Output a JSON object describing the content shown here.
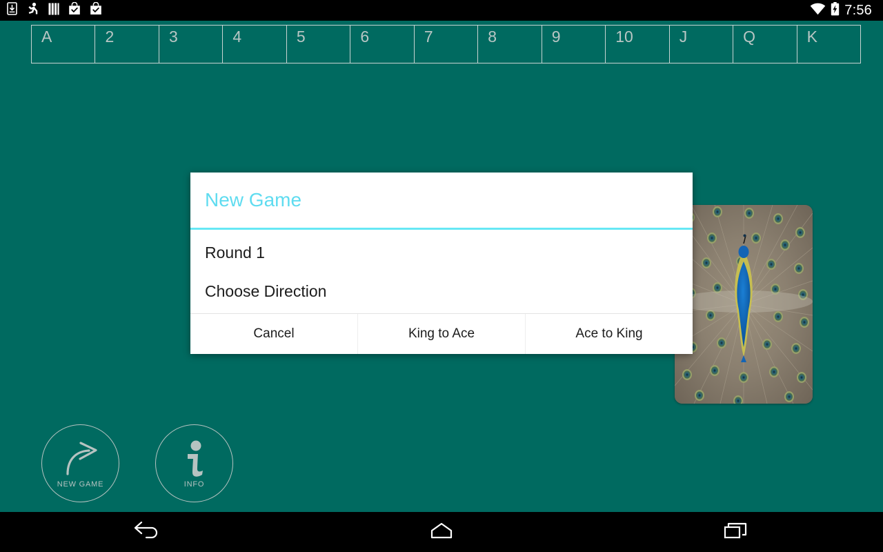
{
  "statusbar": {
    "time": "7:56",
    "left_icons": [
      {
        "name": "download-to-device-icon"
      },
      {
        "name": "running-figure-app-icon"
      },
      {
        "name": "vertical-bars-icon"
      },
      {
        "name": "shopping-bag-check-icon"
      },
      {
        "name": "shopping-bag-check-icon-2"
      }
    ],
    "right_icons": [
      {
        "name": "wifi-icon"
      },
      {
        "name": "battery-charging-icon"
      }
    ]
  },
  "board": {
    "rank_slots": [
      {
        "label": "A"
      },
      {
        "label": "2"
      },
      {
        "label": "3"
      },
      {
        "label": "4"
      },
      {
        "label": "5"
      },
      {
        "label": "6"
      },
      {
        "label": "7"
      },
      {
        "label": "8"
      },
      {
        "label": "9"
      },
      {
        "label": "10"
      },
      {
        "label": "J"
      },
      {
        "label": "Q"
      },
      {
        "label": "K"
      }
    ],
    "deck_card": {
      "name": "peacock-card-back",
      "alt": "Peacock with fanned tail feathers card back"
    },
    "actions": [
      {
        "name": "new-game",
        "icon": "curved-arrow-icon",
        "label": "NEW GAME"
      },
      {
        "name": "info",
        "icon": "info-i-icon",
        "label": "INFO"
      }
    ]
  },
  "dialog": {
    "title": "New Game",
    "line1": "Round 1",
    "line2": "Choose Direction",
    "buttons": [
      {
        "name": "cancel",
        "label": "Cancel"
      },
      {
        "name": "king-to-ace",
        "label": "King to Ace"
      },
      {
        "name": "ace-to-king",
        "label": "Ace to King"
      }
    ]
  },
  "navbar": {
    "buttons": [
      {
        "name": "back",
        "icon": "back-arrow-icon"
      },
      {
        "name": "home",
        "icon": "home-icon"
      },
      {
        "name": "recents",
        "icon": "recents-icon"
      }
    ]
  },
  "colors": {
    "background_teal": "#006a60",
    "accent_cyan": "#67e8f5",
    "title_cyan": "#5fdcf0",
    "slot_border": "#c9d4d2",
    "dialog_bg": "#ffffff",
    "systembar_black": "#000000"
  }
}
